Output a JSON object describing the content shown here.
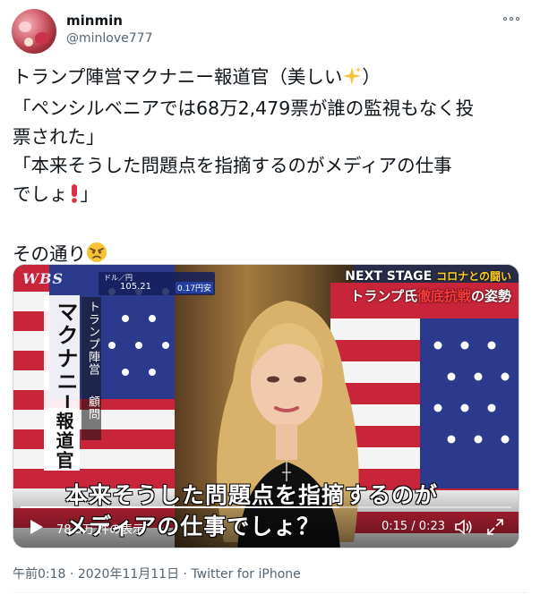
{
  "user": {
    "name": "minmin",
    "handle": "@minlove777"
  },
  "tweet": {
    "line1": "トランプ陣営マクナニー報道官（美しい",
    "line1_end": "）",
    "line2": "「ペンシルベニアでは68万2,479票が誰の監視もなく投",
    "line3": "票された」",
    "line4": "「本来そうした問題点を指摘するのがメディアの仕事",
    "line5": "でしょ",
    "line5_end": "」",
    "line6": "その通り"
  },
  "icons": {
    "sparkle": "sparkles-emoji",
    "exclamation": "red-exclamation-emoji",
    "angry": "angry-face-emoji",
    "more": "more-options-icon",
    "play": "play-icon",
    "volume": "volume-icon",
    "fullscreen": "fullscreen-icon"
  },
  "video": {
    "wbs_logo": "WBS",
    "fx_label": "ドル／円",
    "fx_rate": "105.21",
    "fx_change": "0.17円安",
    "next_stage": "NEXT STAGE",
    "next_stage_topic": "コロナとの闘い",
    "headline_a": "トランプ氏",
    "headline_b": "徹底抗戦",
    "headline_c": "の姿勢",
    "side_title": "マクナニー",
    "side_title2": "報道官",
    "side_affil": "トランプ陣営",
    "side_role": "顧問",
    "subtitle1": "本来そうした問題点を指摘するのが",
    "subtitle2": "メディアの仕事でしょ？",
    "views": "78.5万 件の表示",
    "time": "0:15 / 0:23",
    "progress": 0.65
  },
  "meta": {
    "time": "午前0:18",
    "date": "2020年11月11日",
    "source": "Twitter for iPhone"
  }
}
